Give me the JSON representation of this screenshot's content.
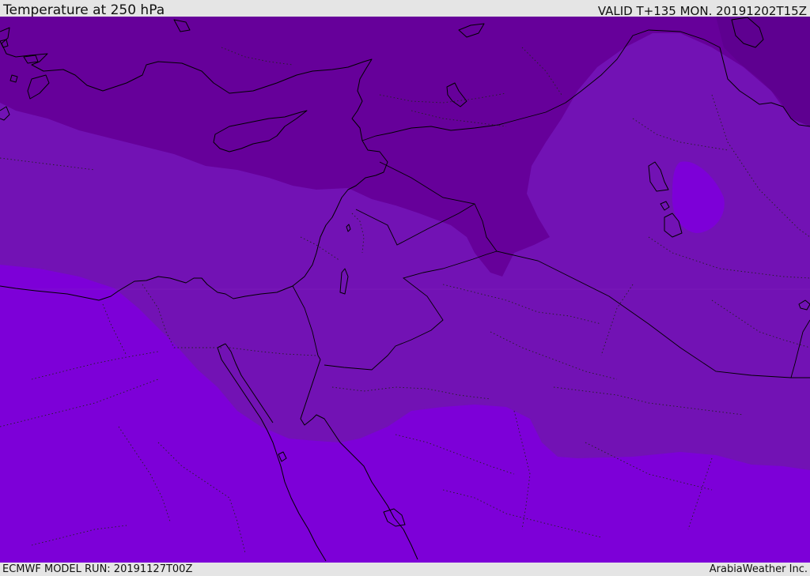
{
  "header": {
    "title": "Temperature at 250 hPa",
    "valid": "VALID T+135 MON. 20191202T15Z"
  },
  "footer": {
    "model_run": "ECMWF MODEL RUN: 20191127T00Z",
    "credit": "ArabiaWeather Inc."
  },
  "colors": {
    "band_darkest": "#5e0090",
    "band_dark": "#66009a",
    "band_mid": "#7212b4",
    "band_light": "#7d00d8",
    "frame": "#e5e5e5",
    "lines": "#000000"
  }
}
